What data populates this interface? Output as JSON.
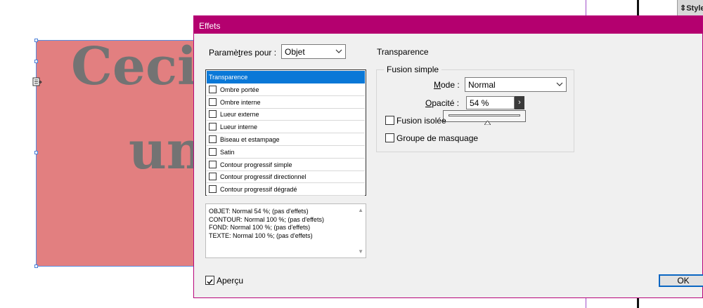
{
  "canvas": {
    "text_line1": "Ceci",
    "text_line2": "un",
    "box_color": "#e27f80",
    "text_color": "#737373"
  },
  "styles_panel": {
    "label": "Style"
  },
  "dialog": {
    "title": "Effets",
    "settings_for_label_pre": "Paramè",
    "settings_for_label_accel": "t",
    "settings_for_label_post": "res pour :",
    "settings_for_value": "Objet",
    "section_title": "Transparence",
    "effects": [
      {
        "label": "Transparence",
        "selected": true
      },
      {
        "label": "Ombre portée",
        "checked": false
      },
      {
        "label": "Ombre interne",
        "checked": false
      },
      {
        "label": "Lueur externe",
        "checked": false
      },
      {
        "label": "Lueur interne",
        "checked": false
      },
      {
        "label": "Biseau et estampage",
        "checked": false
      },
      {
        "label": "Satin",
        "checked": false
      },
      {
        "label": "Contour progressif simple",
        "checked": false
      },
      {
        "label": "Contour progressif directionnel",
        "checked": false
      },
      {
        "label": "Contour progressif dégradé",
        "checked": false
      }
    ],
    "summary": [
      "OBJET: Normal 54 %; (pas d'effets)",
      "CONTOUR: Normal 100 %; (pas d'effets)",
      "FOND: Normal 100 %; (pas d'effets)",
      "TEXTE: Normal 100 %; (pas d'effets)"
    ],
    "group_title": "Fusion simple",
    "mode_label_accel": "M",
    "mode_label_post": "ode :",
    "mode_value": "Normal",
    "opacity_label_accel": "O",
    "opacity_label_post": "pacité :",
    "opacity_value": "54 %",
    "opacity_fraction": 0.54,
    "isolate_label": "Fusion isolée",
    "isolate_checked": false,
    "knockout_label": "Groupe de masquage",
    "knockout_checked": false,
    "preview_label": "Aperçu",
    "preview_checked": true,
    "ok_label": "OK",
    "accent_color": "#b4006f",
    "selection_color": "#0a78d7"
  }
}
